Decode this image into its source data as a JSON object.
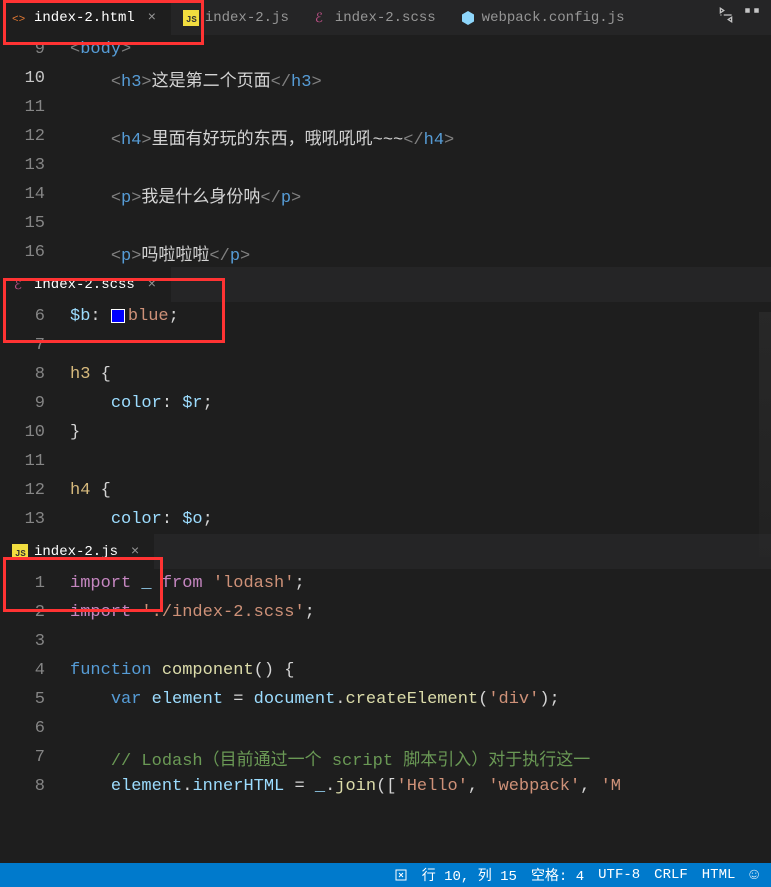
{
  "topTabs": {
    "tab1": {
      "label": "index-2.html",
      "active": true
    },
    "tab2": {
      "label": "index-2.js"
    },
    "tab3": {
      "label": "index-2.scss"
    },
    "tab4": {
      "label": "webpack.config.js"
    }
  },
  "pane1": {
    "lines": [
      {
        "num": "9",
        "tokens": [
          {
            "t": "<",
            "c": "tag-bracket"
          },
          {
            "t": "body",
            "c": "tag-name"
          },
          {
            "t": ">",
            "c": "tag-bracket"
          }
        ]
      },
      {
        "num": "10",
        "current": true,
        "indent": "    ",
        "tokens": [
          {
            "t": "<",
            "c": "tag-bracket"
          },
          {
            "t": "h3",
            "c": "tag-name"
          },
          {
            "t": ">",
            "c": "tag-bracket"
          },
          {
            "t": "这是第二个页面",
            "c": "html-text"
          },
          {
            "t": "</",
            "c": "tag-bracket"
          },
          {
            "t": "h3",
            "c": "tag-name"
          },
          {
            "t": ">",
            "c": "tag-bracket"
          }
        ]
      },
      {
        "num": "11"
      },
      {
        "num": "12",
        "indent": "    ",
        "tokens": [
          {
            "t": "<",
            "c": "tag-bracket"
          },
          {
            "t": "h4",
            "c": "tag-name"
          },
          {
            "t": ">",
            "c": "tag-bracket"
          },
          {
            "t": "里面有好玩的东西，哦吼吼吼~~~",
            "c": "html-text"
          },
          {
            "t": "</",
            "c": "tag-bracket"
          },
          {
            "t": "h4",
            "c": "tag-name"
          },
          {
            "t": ">",
            "c": "tag-bracket"
          }
        ]
      },
      {
        "num": "13"
      },
      {
        "num": "14",
        "indent": "    ",
        "tokens": [
          {
            "t": "<",
            "c": "tag-bracket"
          },
          {
            "t": "p",
            "c": "tag-name"
          },
          {
            "t": ">",
            "c": "tag-bracket"
          },
          {
            "t": "我是什么身份呐",
            "c": "html-text"
          },
          {
            "t": "</",
            "c": "tag-bracket"
          },
          {
            "t": "p",
            "c": "tag-name"
          },
          {
            "t": ">",
            "c": "tag-bracket"
          }
        ]
      },
      {
        "num": "15"
      },
      {
        "num": "16",
        "indent": "    ",
        "tokens": [
          {
            "t": "<",
            "c": "tag-bracket"
          },
          {
            "t": "p",
            "c": "tag-name"
          },
          {
            "t": ">",
            "c": "tag-bracket"
          },
          {
            "t": "吗啦啦啦",
            "c": "html-text"
          },
          {
            "t": "</",
            "c": "tag-bracket"
          },
          {
            "t": "p",
            "c": "tag-name"
          },
          {
            "t": ">",
            "c": "tag-bracket"
          }
        ]
      }
    ]
  },
  "midTab": {
    "label": "index-2.scss"
  },
  "pane2": {
    "swatchColor": "#0000ff",
    "lines": [
      {
        "num": "6",
        "tokens": [
          {
            "t": "$b",
            "c": "scss-var"
          },
          {
            "t": ":",
            "c": "punct"
          },
          {
            "t": " ",
            "c": "punct"
          },
          {
            "swatch": true
          },
          {
            "t": "blue",
            "c": "scss-val"
          },
          {
            "t": ";",
            "c": "punct"
          }
        ]
      },
      {
        "num": "7"
      },
      {
        "num": "8",
        "tokens": [
          {
            "t": "h3",
            "c": "scss-sel"
          },
          {
            "t": " ",
            "c": "punct"
          },
          {
            "t": "{",
            "c": "punct"
          }
        ]
      },
      {
        "num": "9",
        "indent": "    ",
        "tokens": [
          {
            "t": "color",
            "c": "scss-prop"
          },
          {
            "t": ": ",
            "c": "punct"
          },
          {
            "t": "$r",
            "c": "scss-var"
          },
          {
            "t": ";",
            "c": "punct"
          }
        ]
      },
      {
        "num": "10",
        "tokens": [
          {
            "t": "}",
            "c": "punct"
          }
        ]
      },
      {
        "num": "11"
      },
      {
        "num": "12",
        "tokens": [
          {
            "t": "h4",
            "c": "scss-sel"
          },
          {
            "t": " ",
            "c": "punct"
          },
          {
            "t": "{",
            "c": "punct"
          }
        ]
      },
      {
        "num": "13",
        "indent": "    ",
        "tokens": [
          {
            "t": "color",
            "c": "scss-prop"
          },
          {
            "t": ": ",
            "c": "punct"
          },
          {
            "t": "$o",
            "c": "scss-var"
          },
          {
            "t": ";",
            "c": "punct"
          }
        ]
      }
    ]
  },
  "bottomTab": {
    "label": "index-2.js"
  },
  "pane3": {
    "lines": [
      {
        "num": "1",
        "tokens": [
          {
            "t": "import",
            "c": "keyword2"
          },
          {
            "t": " _ ",
            "c": "variable"
          },
          {
            "t": "from",
            "c": "keyword2"
          },
          {
            "t": " ",
            "c": "punct"
          },
          {
            "t": "'lodash'",
            "c": "string"
          },
          {
            "t": ";",
            "c": "punct"
          }
        ]
      },
      {
        "num": "2",
        "tokens": [
          {
            "t": "import",
            "c": "keyword2"
          },
          {
            "t": " ",
            "c": "punct"
          },
          {
            "t": "'./index-2.scss'",
            "c": "string"
          },
          {
            "t": ";",
            "c": "punct"
          }
        ]
      },
      {
        "num": "3"
      },
      {
        "num": "4",
        "tokens": [
          {
            "t": "function",
            "c": "keyword"
          },
          {
            "t": " ",
            "c": "punct"
          },
          {
            "t": "component",
            "c": "func"
          },
          {
            "t": "()",
            "c": "punct"
          },
          {
            "t": " ",
            "c": "punct"
          },
          {
            "t": "{",
            "c": "punct"
          }
        ]
      },
      {
        "num": "5",
        "indent": "    ",
        "tokens": [
          {
            "t": "var",
            "c": "keyword"
          },
          {
            "t": " ",
            "c": "punct"
          },
          {
            "t": "element",
            "c": "variable"
          },
          {
            "t": " = ",
            "c": "punct"
          },
          {
            "t": "document",
            "c": "variable"
          },
          {
            "t": ".",
            "c": "punct"
          },
          {
            "t": "createElement",
            "c": "func"
          },
          {
            "t": "(",
            "c": "punct"
          },
          {
            "t": "'div'",
            "c": "string"
          },
          {
            "t": ")",
            "c": "punct"
          },
          {
            "t": ";",
            "c": "punct"
          }
        ]
      },
      {
        "num": "6"
      },
      {
        "num": "7",
        "indent": "    ",
        "tokens": [
          {
            "t": "// Lodash（目前通过一个 script 脚本引入）对于执行这一",
            "c": "comment"
          }
        ]
      },
      {
        "num": "8",
        "indent": "    ",
        "tokens": [
          {
            "t": "element",
            "c": "variable"
          },
          {
            "t": ".",
            "c": "punct"
          },
          {
            "t": "innerHTML",
            "c": "prop"
          },
          {
            "t": " = ",
            "c": "punct"
          },
          {
            "t": "_",
            "c": "variable"
          },
          {
            "t": ".",
            "c": "punct"
          },
          {
            "t": "join",
            "c": "func"
          },
          {
            "t": "([",
            "c": "punct"
          },
          {
            "t": "'Hello'",
            "c": "string"
          },
          {
            "t": ", ",
            "c": "punct"
          },
          {
            "t": "'webpack'",
            "c": "string"
          },
          {
            "t": ", ",
            "c": "punct"
          },
          {
            "t": "'M",
            "c": "string"
          }
        ]
      }
    ]
  },
  "statusBar": {
    "position": "行 10, 列 15",
    "spaces": "空格: 4",
    "encoding": "UTF-8",
    "eol": "CRLF",
    "lang": "HTML"
  }
}
